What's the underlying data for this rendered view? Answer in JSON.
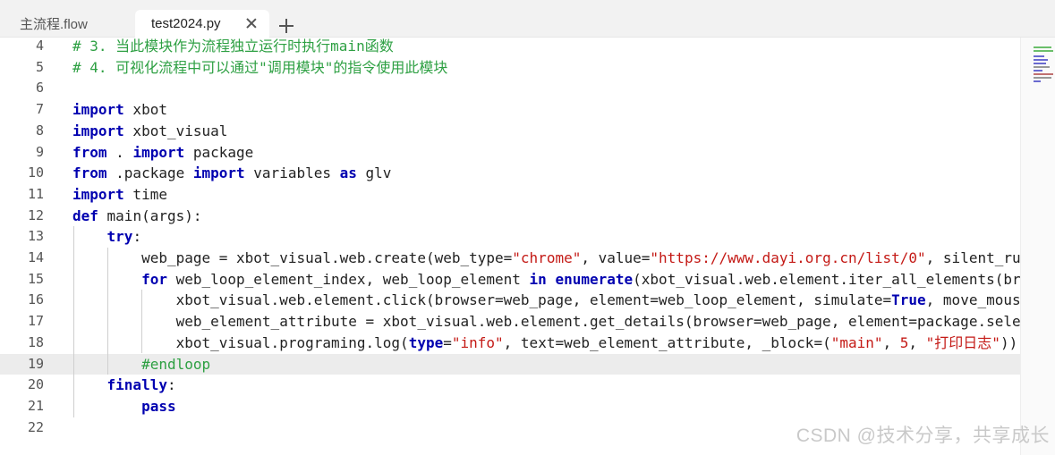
{
  "tabs": [
    {
      "label": "主流程.flow",
      "active": false
    },
    {
      "label": "test2024.py",
      "active": true
    }
  ],
  "editor": {
    "lines": [
      {
        "num": "4",
        "tokens": [
          {
            "t": "# 3. 当此模块作为流程独立运行时执行main函数",
            "c": "cm"
          }
        ]
      },
      {
        "num": "5",
        "tokens": [
          {
            "t": "# 4. 可视化流程中可以通过\"调用模块\"的指令使用此模块",
            "c": "cm"
          }
        ]
      },
      {
        "num": "6",
        "tokens": []
      },
      {
        "num": "7",
        "tokens": [
          {
            "t": "import",
            "c": "kw"
          },
          {
            "t": " xbot"
          }
        ]
      },
      {
        "num": "8",
        "tokens": [
          {
            "t": "import",
            "c": "kw"
          },
          {
            "t": " xbot_visual"
          }
        ]
      },
      {
        "num": "9",
        "tokens": [
          {
            "t": "from",
            "c": "kw"
          },
          {
            "t": " . "
          },
          {
            "t": "import",
            "c": "kw"
          },
          {
            "t": " package"
          }
        ]
      },
      {
        "num": "10",
        "tokens": [
          {
            "t": "from",
            "c": "kw"
          },
          {
            "t": " .package "
          },
          {
            "t": "import",
            "c": "kw"
          },
          {
            "t": " variables "
          },
          {
            "t": "as",
            "c": "kw"
          },
          {
            "t": " glv"
          }
        ]
      },
      {
        "num": "11",
        "tokens": [
          {
            "t": "import",
            "c": "kw"
          },
          {
            "t": " time"
          }
        ]
      },
      {
        "num": "12",
        "tokens": [
          {
            "t": "def",
            "c": "kw"
          },
          {
            "t": " main(args):"
          }
        ]
      },
      {
        "num": "13",
        "tokens": [
          {
            "t": "    "
          },
          {
            "t": "try",
            "c": "kw"
          },
          {
            "t": ":"
          }
        ]
      },
      {
        "num": "14",
        "tokens": [
          {
            "t": "        web_page = xbot_visual.web.create(web_type="
          },
          {
            "t": "\"chrome\"",
            "c": "st"
          },
          {
            "t": ", value="
          },
          {
            "t": "\"https://www.dayi.org.cn/list/0\"",
            "c": "st"
          },
          {
            "t": ", silent_ru"
          }
        ]
      },
      {
        "num": "15",
        "tokens": [
          {
            "t": "        "
          },
          {
            "t": "for",
            "c": "kw"
          },
          {
            "t": " web_loop_element_index, web_loop_element "
          },
          {
            "t": "in",
            "c": "kw"
          },
          {
            "t": " "
          },
          {
            "t": "enumerate",
            "c": "kw"
          },
          {
            "t": "(xbot_visual.web.element.iter_all_elements(bro"
          }
        ]
      },
      {
        "num": "16",
        "tokens": [
          {
            "t": "            xbot_visual.web.element.click(browser=web_page, element=web_loop_element, simulate="
          },
          {
            "t": "True",
            "c": "kw"
          },
          {
            "t": ", move_mous"
          }
        ]
      },
      {
        "num": "17",
        "tokens": [
          {
            "t": "            web_element_attribute = xbot_visual.web.element.get_details(browser=web_page, element=package.sele"
          }
        ]
      },
      {
        "num": "18",
        "tokens": [
          {
            "t": "            xbot_visual.programing.log("
          },
          {
            "t": "type",
            "c": "kw"
          },
          {
            "t": "="
          },
          {
            "t": "\"info\"",
            "c": "st"
          },
          {
            "t": ", text=web_element_attribute, _block=("
          },
          {
            "t": "\"main\"",
            "c": "st"
          },
          {
            "t": ", "
          },
          {
            "t": "5",
            "c": "st"
          },
          {
            "t": ", "
          },
          {
            "t": "\"打印日志\"",
            "c": "st"
          },
          {
            "t": "))"
          }
        ]
      },
      {
        "num": "19",
        "tokens": [
          {
            "t": "        "
          },
          {
            "t": "#endloop",
            "c": "cm"
          }
        ],
        "current": true
      },
      {
        "num": "20",
        "tokens": [
          {
            "t": "    "
          },
          {
            "t": "finally",
            "c": "kw"
          },
          {
            "t": ":"
          }
        ]
      },
      {
        "num": "21",
        "tokens": [
          {
            "t": "        "
          },
          {
            "t": "pass",
            "c": "kw"
          }
        ]
      },
      {
        "num": "22",
        "tokens": []
      }
    ]
  },
  "watermark": "CSDN @技术分享，共享成长",
  "colors": {
    "keyword": "#0000b0",
    "comment": "#2ea043",
    "string": "#c41a16"
  }
}
